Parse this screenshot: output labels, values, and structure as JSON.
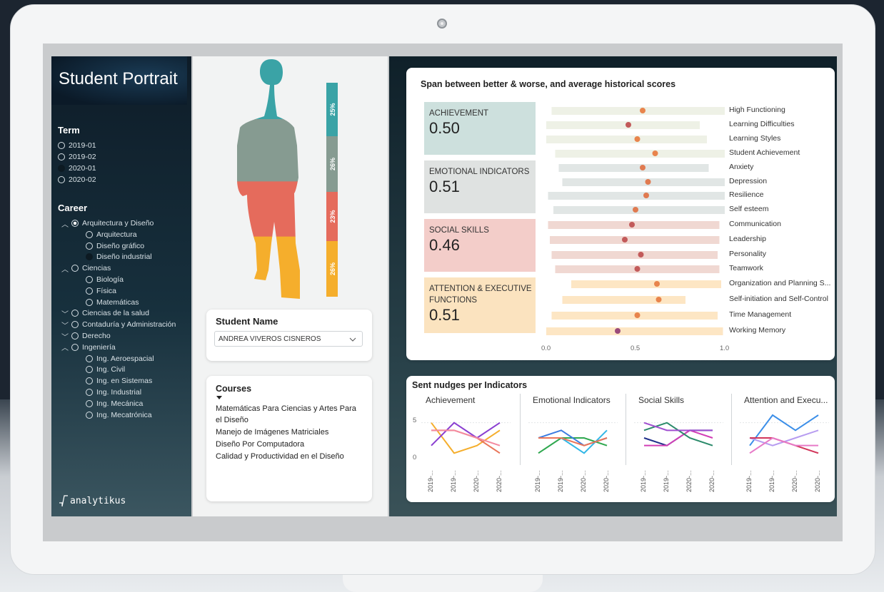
{
  "sidebar": {
    "title": "Student Portrait",
    "term_heading": "Term",
    "terms": [
      {
        "label": "2019-01",
        "state": "off"
      },
      {
        "label": "2019-02",
        "state": "off"
      },
      {
        "label": "2020-01",
        "state": "fill"
      },
      {
        "label": "2020-02",
        "state": "off"
      }
    ],
    "career_heading": "Career",
    "careers": [
      {
        "label": "Arquitectura y Diseño",
        "chev": "^",
        "state": "on",
        "level": 0
      },
      {
        "label": "Arquitectura",
        "state": "off",
        "level": 1
      },
      {
        "label": "Diseño gráfico",
        "state": "off",
        "level": 1
      },
      {
        "label": "Diseño industrial",
        "state": "fill",
        "level": 1
      },
      {
        "label": "Ciencias",
        "chev": "^",
        "state": "off",
        "level": 0
      },
      {
        "label": "Biología",
        "state": "off",
        "level": 1
      },
      {
        "label": "Física",
        "state": "off",
        "level": 1
      },
      {
        "label": "Matemáticas",
        "state": "off",
        "level": 1
      },
      {
        "label": "Ciencias de la salud",
        "chev": "v",
        "state": "off",
        "level": 0
      },
      {
        "label": "Contaduría y Administración",
        "chev": "v",
        "state": "off",
        "level": 0
      },
      {
        "label": "Derecho",
        "chev": "v",
        "state": "off",
        "level": 0
      },
      {
        "label": "Ingeniería",
        "chev": "^",
        "state": "off",
        "level": 0
      },
      {
        "label": "Ing. Aeroespacial",
        "state": "off",
        "level": 1
      },
      {
        "label": "Ing. Civil",
        "state": "off",
        "level": 1
      },
      {
        "label": "Ing. en Sistemas",
        "state": "off",
        "level": 1
      },
      {
        "label": "Ing. Industrial",
        "state": "off",
        "level": 1
      },
      {
        "label": "Ing. Mecánica",
        "state": "off",
        "level": 1
      },
      {
        "label": "Ing. Mecatrónica",
        "state": "off",
        "level": 1
      }
    ],
    "logo_text": "analytikus"
  },
  "portrait": {
    "segments": [
      {
        "label": "25%",
        "value": 25,
        "color": "#3aa3a6"
      },
      {
        "label": "26%",
        "value": 26,
        "color": "#869b91"
      },
      {
        "label": "23%",
        "value": 23,
        "color": "#e56b5c"
      },
      {
        "label": "26%",
        "value": 26,
        "color": "#f5ae2c"
      }
    ]
  },
  "student": {
    "heading": "Student Name",
    "selected": "ANDREA VIVEROS CISNEROS"
  },
  "courses": {
    "heading": "Courses",
    "items": [
      "Matemáticas Para Ciencias y Artes Para el Diseño",
      "Manejo de Imágenes Matriciales",
      "Diseño Por Computadora",
      "Calidad y Productividad en el Diseño"
    ]
  },
  "span_chart": {
    "title": "Span between better & worse, and average historical scores",
    "categories": [
      {
        "name": "ACHIEVEMENT",
        "value": "0.50",
        "bg": "#cde0dd"
      },
      {
        "name": "EMOTIONAL INDICATORS",
        "value": "0.51",
        "bg": "#dfe2e1"
      },
      {
        "name": "SOCIAL SKILLS",
        "value": "0.46",
        "bg": "#f3cdc9"
      },
      {
        "name": "ATTENTION & EXECUTIVE FUNCTIONS",
        "value": "0.51",
        "bg": "#fbe3bf"
      }
    ],
    "axis_ticks": [
      "0.0",
      "0.5",
      "1.0"
    ]
  },
  "chart_data": [
    {
      "type": "range-dot",
      "title": "Span between better & worse, and average historical scores",
      "xlim": [
        0,
        1
      ],
      "rows": [
        {
          "label": "High Functioning",
          "min": 0.03,
          "max": 1.0,
          "avg": 0.54,
          "group": 0
        },
        {
          "label": "Learning Difficulties",
          "min": 0.0,
          "max": 0.86,
          "avg": 0.46,
          "group": 0
        },
        {
          "label": "Learning Styles",
          "min": 0.0,
          "max": 0.9,
          "avg": 0.51,
          "group": 0
        },
        {
          "label": "Student Achievement",
          "min": 0.05,
          "max": 1.0,
          "avg": 0.61,
          "group": 0
        },
        {
          "label": "Anxiety",
          "min": 0.07,
          "max": 0.91,
          "avg": 0.54,
          "group": 1
        },
        {
          "label": "Depression",
          "min": 0.09,
          "max": 1.0,
          "avg": 0.57,
          "group": 1
        },
        {
          "label": "Resilience",
          "min": 0.01,
          "max": 1.0,
          "avg": 0.56,
          "group": 1
        },
        {
          "label": "Self esteem",
          "min": 0.04,
          "max": 1.0,
          "avg": 0.5,
          "group": 1
        },
        {
          "label": "Communication",
          "min": 0.01,
          "max": 0.97,
          "avg": 0.48,
          "group": 2
        },
        {
          "label": "Leadership",
          "min": 0.02,
          "max": 0.97,
          "avg": 0.44,
          "group": 2
        },
        {
          "label": "Personality",
          "min": 0.03,
          "max": 0.96,
          "avg": 0.53,
          "group": 2
        },
        {
          "label": "Teamwork",
          "min": 0.05,
          "max": 0.97,
          "avg": 0.51,
          "group": 2
        },
        {
          "label": "Organization and Planning S...",
          "min": 0.14,
          "max": 0.98,
          "avg": 0.62,
          "group": 3
        },
        {
          "label": "Self-initiation and Self-Control",
          "min": 0.09,
          "max": 0.78,
          "avg": 0.63,
          "group": 3
        },
        {
          "label": "Time Management",
          "min": 0.03,
          "max": 0.96,
          "avg": 0.51,
          "group": 3
        },
        {
          "label": "Working Memory",
          "min": 0.0,
          "max": 0.99,
          "avg": 0.4,
          "group": 3
        }
      ]
    },
    {
      "type": "line",
      "title": "Sent nudges per Indicators",
      "ylim": [
        0,
        6
      ],
      "yticks": [
        "5",
        "0"
      ],
      "x": [
        "2019-...",
        "2019-...",
        "2020-...",
        "2020-..."
      ],
      "panels": [
        {
          "name": "Achievement",
          "series": [
            {
              "color": "#f5ae2c",
              "values": [
                5,
                1,
                2,
                4
              ]
            },
            {
              "color": "#e9765a",
              "values": [
                4,
                4,
                3,
                1
              ]
            },
            {
              "color": "#8a3fd1",
              "values": [
                2,
                5,
                3,
                5
              ]
            },
            {
              "color": "#f48aa0",
              "values": [
                4,
                4,
                3,
                2
              ]
            }
          ]
        },
        {
          "name": "Emotional Indicators",
          "series": [
            {
              "color": "#2fa84f",
              "values": [
                1,
                3,
                3,
                2
              ]
            },
            {
              "color": "#33b7e6",
              "values": [
                3,
                3,
                1,
                4
              ]
            },
            {
              "color": "#3b7be0",
              "values": [
                3,
                4,
                2,
                3
              ]
            },
            {
              "color": "#e9765a",
              "values": [
                3,
                3,
                2,
                3
              ]
            }
          ]
        },
        {
          "name": "Social Skills",
          "series": [
            {
              "color": "#1f2f8a",
              "values": [
                3,
                2,
                4,
                4
              ]
            },
            {
              "color": "#d23fb6",
              "values": [
                2,
                2,
                4,
                3
              ]
            },
            {
              "color": "#2a8a6a",
              "values": [
                4,
                5,
                3,
                2
              ]
            },
            {
              "color": "#a04fd0",
              "values": [
                5,
                4,
                4,
                4
              ]
            }
          ]
        },
        {
          "name": "Attention and Execu...",
          "series": [
            {
              "color": "#3b8ee8",
              "values": [
                2,
                6,
                4,
                6
              ]
            },
            {
              "color": "#b79cf0",
              "values": [
                3,
                2,
                3,
                4
              ]
            },
            {
              "color": "#d2365a",
              "values": [
                3,
                3,
                2,
                1
              ]
            },
            {
              "color": "#e77ac8",
              "values": [
                1,
                3,
                2,
                2
              ]
            }
          ]
        }
      ]
    }
  ]
}
